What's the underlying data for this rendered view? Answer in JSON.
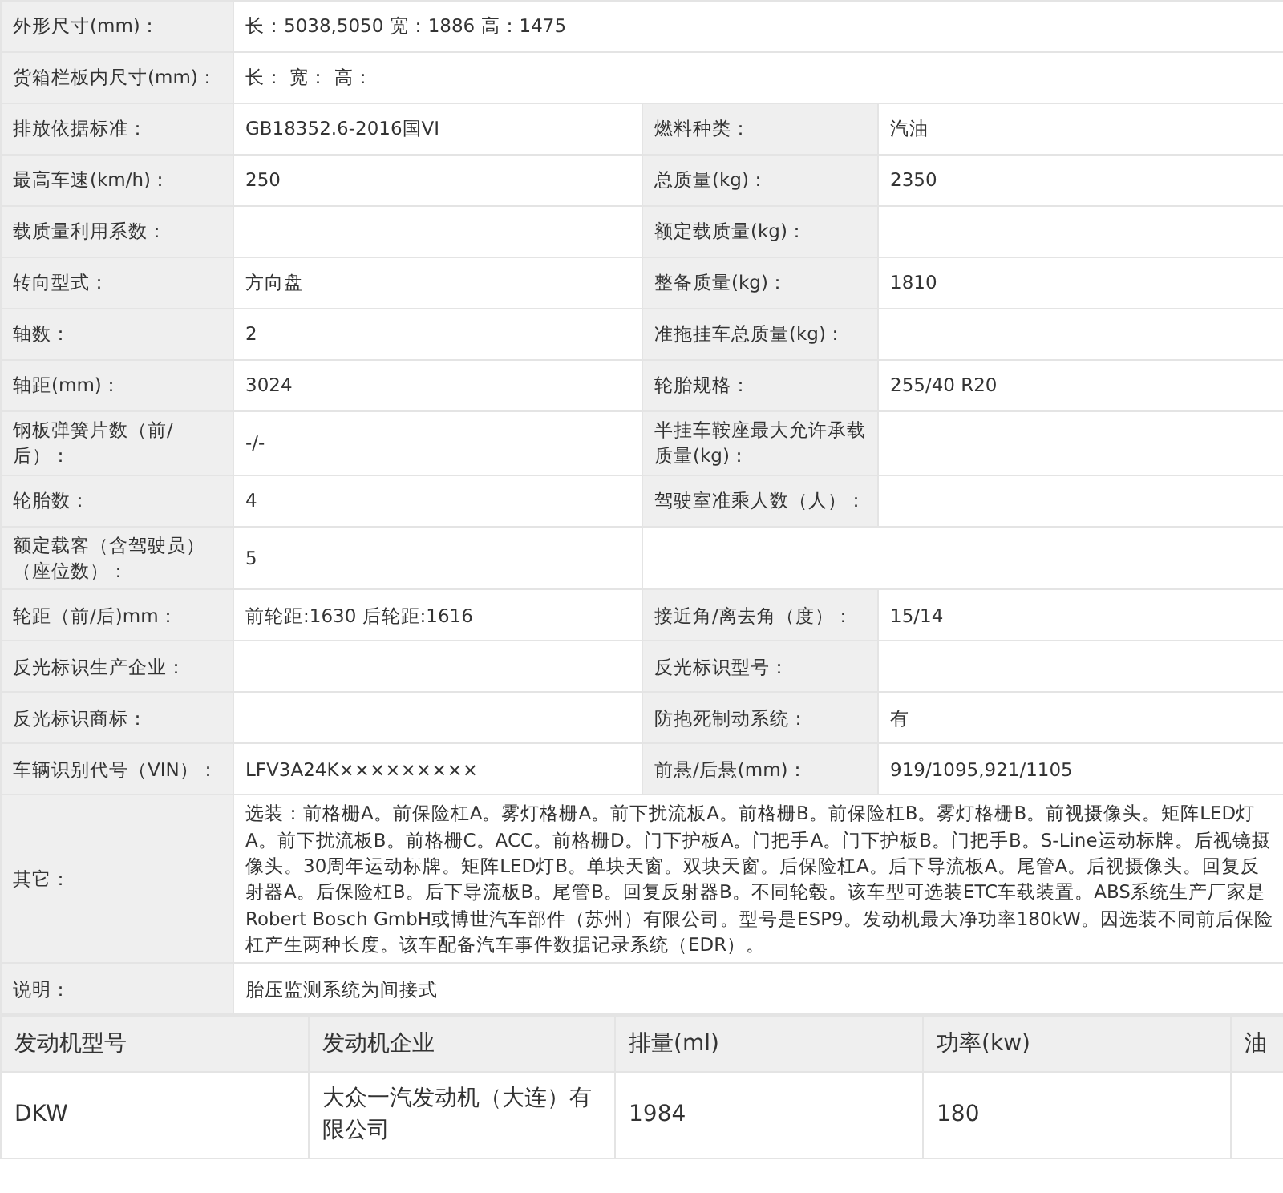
{
  "specs": [
    {
      "kind": "wide",
      "cells": [
        {
          "label": "外形尺寸(mm)：",
          "value": "长：5038,5050 宽：1886 高：1475"
        }
      ]
    },
    {
      "kind": "wide",
      "cells": [
        {
          "label": "货箱栏板内尺寸(mm)：",
          "value": "长：  宽：  高："
        }
      ]
    },
    {
      "kind": "pair",
      "cells": [
        {
          "label": "排放依据标准：",
          "value": "GB18352.6-2016国VI"
        },
        {
          "label": "燃料种类：",
          "value": "汽油"
        }
      ]
    },
    {
      "kind": "pair",
      "cells": [
        {
          "label": "最高车速(km/h)：",
          "value": "250"
        },
        {
          "label": "总质量(kg)：",
          "value": "2350"
        }
      ]
    },
    {
      "kind": "pair",
      "cells": [
        {
          "label": "载质量利用系数："
        },
        {
          "label": "额定载质量(kg)："
        }
      ]
    },
    {
      "kind": "pair",
      "cells": [
        {
          "label": "转向型式：",
          "value": "方向盘"
        },
        {
          "label": "整备质量(kg)：",
          "value": "1810"
        }
      ]
    },
    {
      "kind": "pair",
      "cells": [
        {
          "label": "轴数：",
          "value": "2"
        },
        {
          "label": "准拖挂车总质量(kg)："
        }
      ]
    },
    {
      "kind": "pair",
      "cells": [
        {
          "label": "轴距(mm)：",
          "value": "3024"
        },
        {
          "label": "轮胎规格：",
          "value": "255/40 R20"
        }
      ]
    },
    {
      "kind": "pair",
      "cells": [
        {
          "label": "钢板弹簧片数（前/后）：",
          "value": "-/-"
        },
        {
          "label": "半挂车鞍座最大允许承载质量(kg)："
        }
      ]
    },
    {
      "kind": "pair",
      "cells": [
        {
          "label": "轮胎数：",
          "value": "4"
        },
        {
          "label": "驾驶室准乘人数（人）："
        }
      ]
    },
    {
      "kind": "pair",
      "cells": [
        {
          "label": "额定载客（含驾驶员）（座位数）：",
          "value": "5"
        }
      ]
    },
    {
      "kind": "pair",
      "cells": [
        {
          "label": "轮距（前/后)mm：",
          "value": "前轮距:1630 后轮距:1616"
        },
        {
          "label": "接近角/离去角（度）：",
          "value": "15/14"
        }
      ]
    },
    {
      "kind": "pair",
      "cells": [
        {
          "label": "反光标识生产企业："
        },
        {
          "label": "反光标识型号："
        }
      ]
    },
    {
      "kind": "pair",
      "cells": [
        {
          "label": "反光标识商标："
        },
        {
          "label": "防抱死制动系统：",
          "value": "有"
        }
      ]
    },
    {
      "kind": "pair",
      "cells": [
        {
          "label": "车辆识别代号（VIN）：",
          "value": "LFV3A24K×××××××××"
        },
        {
          "label": "前悬/后悬(mm)：",
          "value": "919/1095,921/1105"
        }
      ]
    },
    {
      "kind": "wide",
      "cells": [
        {
          "label": "其它：",
          "value": "选装：前格栅A。前保险杠A。雾灯格栅A。前下扰流板A。前格栅B。前保险杠B。雾灯格栅B。前视摄像头。矩阵LED灯A。前下扰流板B。前格栅C。ACC。前格栅D。门下护板A。门把手A。门下护板B。门把手B。S-Line运动标牌。后视镜摄像头。30周年运动标牌。矩阵LED灯B。单块天窗。双块天窗。后保险杠A。后下导流板A。尾管A。后视摄像头。回复反射器A。后保险杠B。后下导流板B。尾管B。回复反射器B。不同轮毂。该车型可选装ETC车载装置。ABS系统生产厂家是Robert Bosch GmbH或博世汽车部件（苏州）有限公司。型号是ESP9。发动机最大净功率180kW。因选装不同前后保险杠产生两种长度。该车配备汽车事件数据记录系统（EDR）。"
        }
      ]
    },
    {
      "kind": "wide",
      "cells": [
        {
          "label": "说明：",
          "value": "胎压监测系统为间接式"
        }
      ]
    }
  ],
  "engine_table": {
    "columns": [
      "发动机型号",
      "发动机企业",
      "排量(ml)",
      "功率(kw)",
      "油"
    ],
    "rows": [
      [
        "DKW",
        "大众一汽发动机（大连）有限公司",
        "1984",
        "180"
      ]
    ]
  }
}
